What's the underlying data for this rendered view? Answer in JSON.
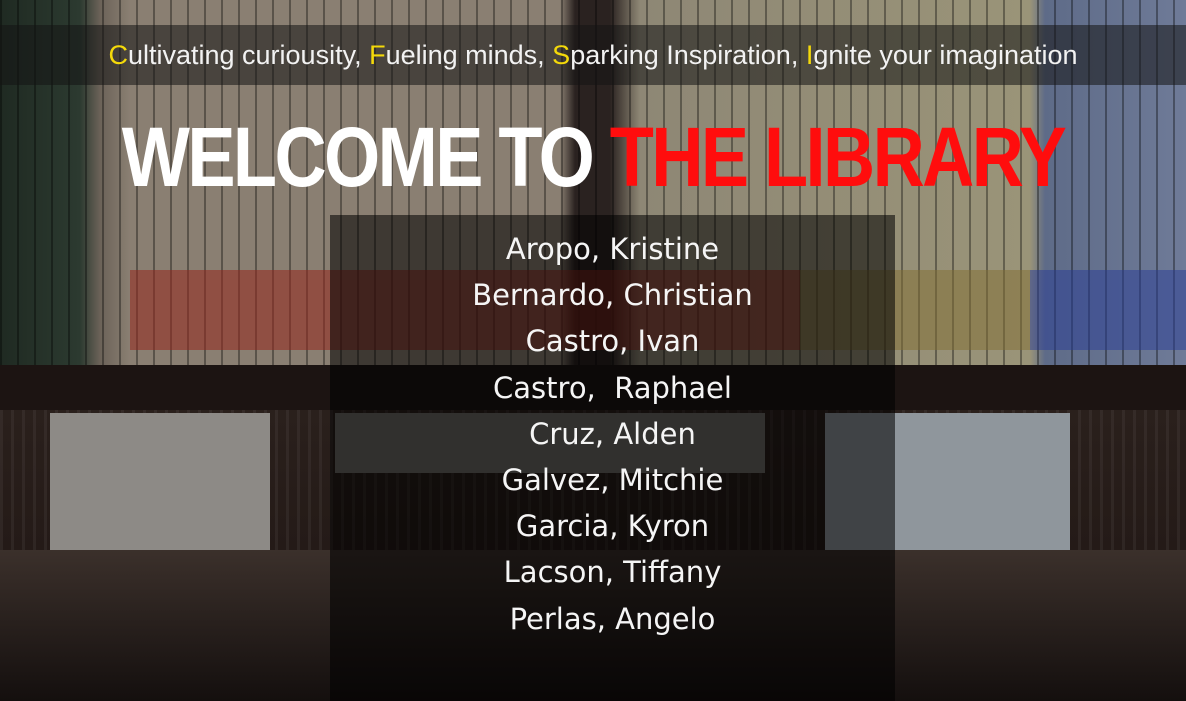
{
  "tagline": {
    "parts": [
      {
        "initial": "C",
        "rest": "ultivating curiousity, "
      },
      {
        "initial": "F",
        "rest": "ueling minds, "
      },
      {
        "initial": "S",
        "rest": "parking Inspiration, "
      },
      {
        "initial": "I",
        "rest": "gnite your imagination"
      }
    ]
  },
  "title": {
    "white": "WELCOME TO ",
    "red": "THE LIBRARY"
  },
  "members": [
    "Aropo, Kristine",
    "Bernardo, Christian",
    "Castro, Ivan",
    "Castro,  Raphael",
    "Cruz, Alden",
    "Galvez, Mitchie",
    "Garcia, Kyron",
    "Lacson, Tiffany",
    "Perlas, Angelo"
  ],
  "colors": {
    "accent_yellow": "#f4d90a",
    "accent_red": "#ff0d0d"
  }
}
